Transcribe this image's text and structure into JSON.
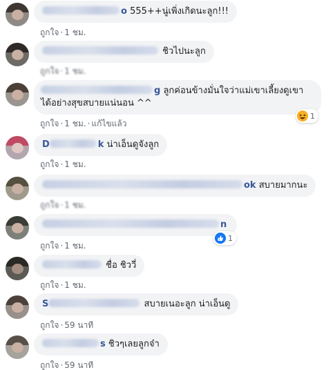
{
  "comments": [
    {
      "message": " 555++นู่เพิ่งเกิดนะลูก!!!",
      "name_prefix": "",
      "name_suffix": "o",
      "like": "ถูกใจ",
      "time": "1 ชม.",
      "edited": ""
    },
    {
      "message": " ชิวไปนะลูก",
      "name_prefix": "",
      "name_suffix": "",
      "like": "ถูกใจ",
      "time": "1 ชม.",
      "edited": ""
    },
    {
      "message_line1": " ลูกค่อนข้างมั่นใจว่าแม่เขาเลี้ยงดูเขา",
      "message_line2": "ได้อย่างสุขสบายแน่นอน ^^",
      "name_suffix": "g",
      "like": "ถูกใจ",
      "time": "1 ชม.",
      "edited": "แก้ไขแล้ว",
      "reaction_count": "1",
      "reaction_icon": "haha-emoji-icon"
    },
    {
      "message": " น่าเอ็นดูจังลูก",
      "name_prefix": "D",
      "name_suffix": "k",
      "like": "ถูกใจ",
      "time": "1 ชม.",
      "edited": ""
    },
    {
      "message": " สบายมากนะ",
      "name_prefix": "",
      "name_suffix": "ok",
      "like": "ถูกใจ",
      "time": "1 ชม.",
      "edited": ""
    },
    {
      "message": "",
      "name_prefix": "",
      "name_suffix": "n",
      "like": "ถูกใจ",
      "time": "1 ชม.",
      "edited": "",
      "reaction_count": "1",
      "reaction_icon": "like-thumb-icon"
    },
    {
      "message": " ชื่อ ชิววี่",
      "name_prefix": "",
      "name_suffix": "",
      "like": "ถูกใจ",
      "time": "1 ชม.",
      "edited": ""
    },
    {
      "message": " สบายเนอะลูก น่าเอ็นดู",
      "name_prefix": "S",
      "name_suffix": "",
      "like": "ถูกใจ",
      "time": "59 นาที",
      "edited": ""
    },
    {
      "message": " ชิวๆเลยลูกจ๋า",
      "name_prefix": "",
      "name_suffix": "s",
      "like": "ถูกใจ",
      "time": "59 นาที",
      "edited": ""
    }
  ],
  "separator": "·",
  "colors": {
    "bubble": "#f2f3f5",
    "name": "#385898",
    "meta": "#606770",
    "like_blue": "#1877f2",
    "haha_yellow": "#f7b125"
  }
}
